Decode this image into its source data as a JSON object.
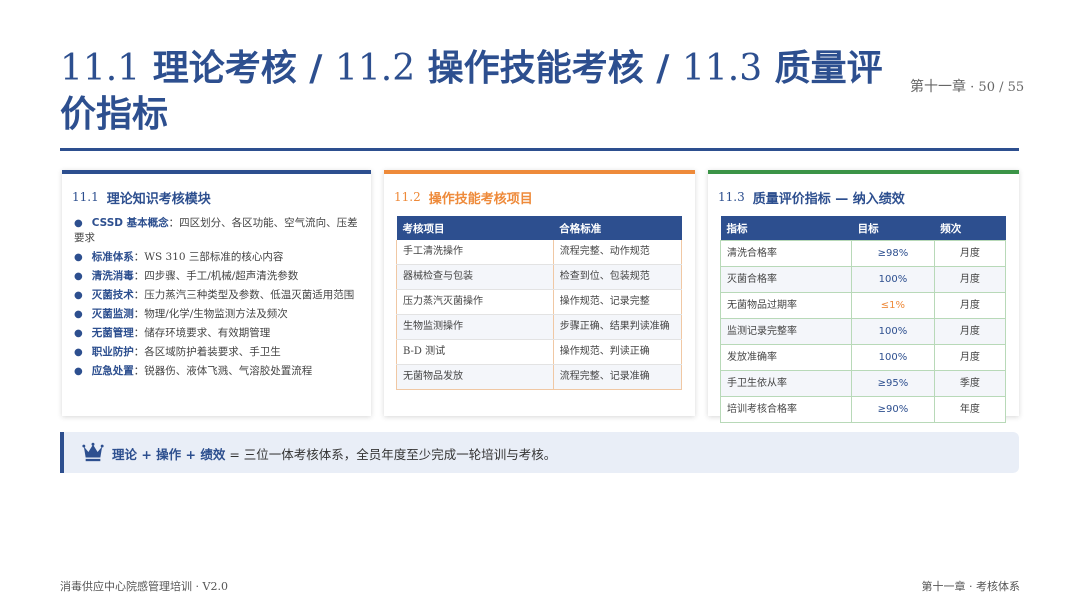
{
  "header": {
    "title_parts": [
      {
        "num": "11.1",
        "text": "理论考核"
      },
      {
        "num": "11.2",
        "text": "操作技能考核"
      },
      {
        "num": "11.3",
        "text": "质量评价指标"
      }
    ],
    "separator": "/",
    "chapter": "第十一章",
    "page_current": "50",
    "page_total": "55"
  },
  "theory": {
    "num": "11.1",
    "title": "理论知识考核模块",
    "items": [
      {
        "term": "CSSD 基本概念",
        "desc": "四区划分、各区功能、空气流向、压差要求"
      },
      {
        "term": "标准体系",
        "desc": "WS 310 三部标准的核心内容"
      },
      {
        "term": "清洗消毒",
        "desc": "四步骤、手工/机械/超声清洗参数"
      },
      {
        "term": "灭菌技术",
        "desc": "压力蒸汽三种类型及参数、低温灭菌适用范围"
      },
      {
        "term": "灭菌监测",
        "desc": "物理/化学/生物监测方法及频次"
      },
      {
        "term": "无菌管理",
        "desc": "储存环境要求、有效期管理"
      },
      {
        "term": "职业防护",
        "desc": "各区域防护着装要求、手卫生"
      },
      {
        "term": "应急处置",
        "desc": "锐器伤、液体飞溅、气溶胶处置流程"
      }
    ]
  },
  "skills": {
    "num": "11.2",
    "title": "操作技能考核项目",
    "headers": [
      "考核项目",
      "合格标准"
    ],
    "rows": [
      [
        "手工清洗操作",
        "流程完整、动作规范"
      ],
      [
        "器械检查与包装",
        "检查到位、包装规范"
      ],
      [
        "压力蒸汽灭菌操作",
        "操作规范、记录完整"
      ],
      [
        "生物监测操作",
        "步骤正确、结果判读准确"
      ],
      [
        "B-D 测试",
        "操作规范、判读正确"
      ],
      [
        "无菌物品发放",
        "流程完整、记录准确"
      ]
    ]
  },
  "quality": {
    "num": "11.3",
    "title": "质量评价指标 — 纳入绩效",
    "headers": [
      "指标",
      "目标",
      "频次"
    ],
    "rows": [
      [
        "清洗合格率",
        "≥98%",
        "月度"
      ],
      [
        "灭菌合格率",
        "100%",
        "月度"
      ],
      [
        "无菌物品过期率",
        "≤1%",
        "月度"
      ],
      [
        "监测记录完整率",
        "100%",
        "月度"
      ],
      [
        "发放准确率",
        "100%",
        "月度"
      ],
      [
        "手卫生依从率",
        "≥95%",
        "季度"
      ],
      [
        "培训考核合格率",
        "≥90%",
        "年度"
      ]
    ],
    "warn_color": "#ee8a3a"
  },
  "banner": {
    "icon": "crown-icon",
    "highlight": "理论 + 操作 + 绩效",
    "text": " = 三位一体考核体系，全员年度至少完成一轮培训与考核。"
  },
  "footer": {
    "left": "消毒供应中心院感管理培训",
    "version": "V2.0",
    "right": "第十一章 · 考核体系"
  },
  "colors": {
    "primary": "#2d4f8f",
    "orange": "#ee8a3a",
    "green": "#3b9447"
  }
}
